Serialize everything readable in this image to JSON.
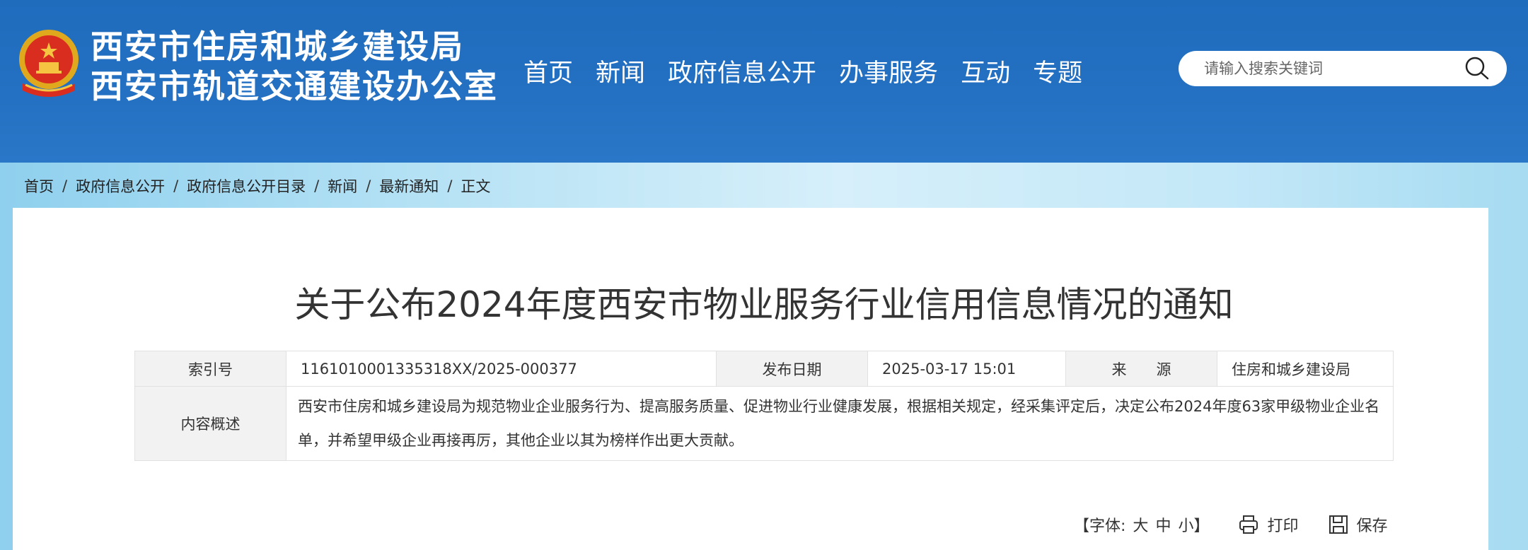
{
  "header": {
    "title_line1": "西安市住房和城乡建设局",
    "title_line2": "西安市轨道交通建设办公室",
    "emblem_icon": "national-emblem-icon",
    "bg_color": "#2470c2"
  },
  "nav": {
    "items": [
      {
        "label": "首页"
      },
      {
        "label": "新闻"
      },
      {
        "label": "政府信息公开"
      },
      {
        "label": "办事服务"
      },
      {
        "label": "互动"
      },
      {
        "label": "专题"
      }
    ]
  },
  "search": {
    "placeholder": "请输入搜索关键词",
    "icon": "search-icon"
  },
  "breadcrumb": {
    "items": [
      "首页",
      "政府信息公开",
      "政府信息公开目录",
      "新闻",
      "最新通知"
    ],
    "current": "正文",
    "separator": "/"
  },
  "article": {
    "title": "关于公布2024年度西安市物业服务行业信用信息情况的通知"
  },
  "meta": {
    "index_label": "索引号",
    "index_value": "1161010001335318XX/2025-000377",
    "date_label": "发布日期",
    "date_value": "2025-03-17 15:01",
    "source_label": "来　　源",
    "source_value": "住房和城乡建设局",
    "summary_label": "内容概述",
    "summary_value": "西安市住房和城乡建设局为规范物业企业服务行为、提高服务质量、促进物业行业健康发展，根据相关规定，经采集评定后，决定公布2024年度63家甲级物业企业名单，并希望甲级企业再接再厉，其他企业以其为榜样作出更大贡献。"
  },
  "tools": {
    "font_open": "【字体:",
    "size_large": "大",
    "size_medium": "中",
    "size_small": "小",
    "font_close": "】",
    "print_label": "打印",
    "save_label": "保存",
    "print_icon": "printer-icon",
    "save_icon": "save-disk-icon"
  }
}
